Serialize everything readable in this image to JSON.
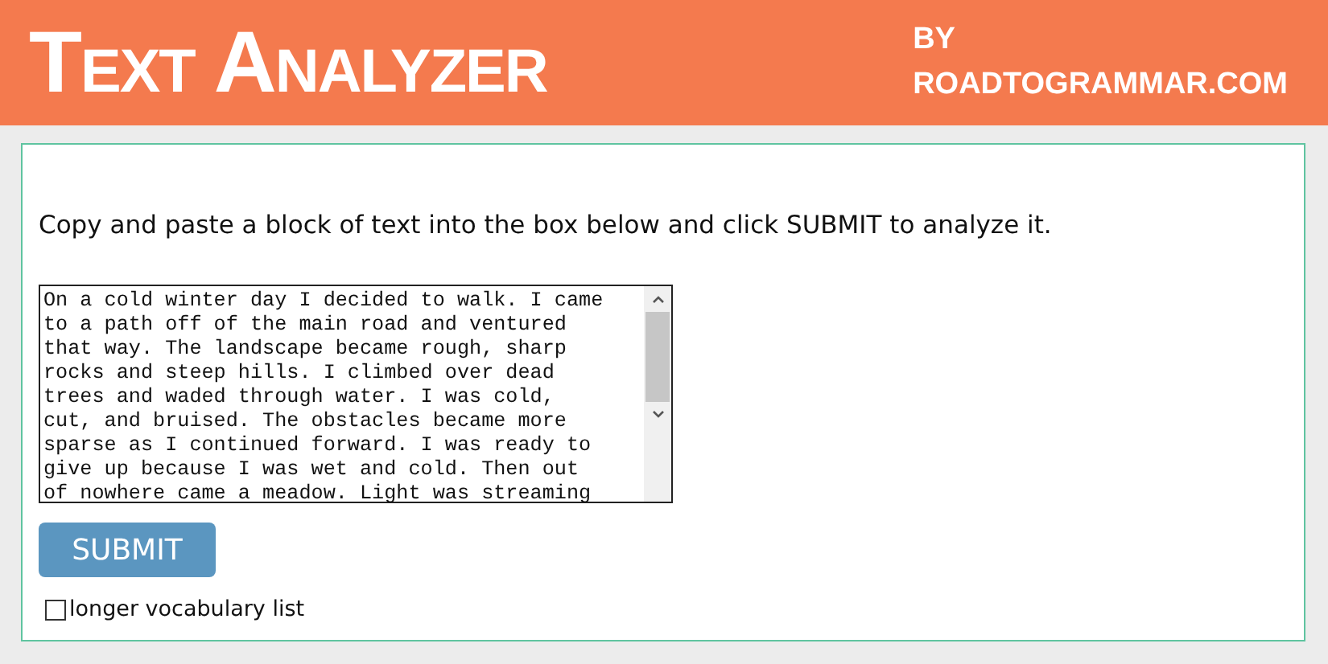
{
  "header": {
    "title": "Text Analyzer",
    "byline": [
      "BY",
      "ROADTOGRAMMAR.COM"
    ]
  },
  "instructions": "Copy and paste a block of text into the box below and click SUBMIT to analyze it.",
  "text_box": {
    "lines": [
      "On a cold winter day I decided to walk. I came",
      "to a path off of the main road and ventured",
      "that way. The landscape became rough, sharp",
      "rocks and steep hills. I climbed over dead",
      "trees and waded through water. I was cold,",
      "cut, and bruised. The obstacles became more",
      "sparse as I continued forward. I was ready to",
      "give up because I was wet and cold. Then out",
      "of nowhere came a meadow. Light was streaming"
    ]
  },
  "submit_button": "SUBMIT",
  "checkbox": {
    "label": "longer vocabulary list",
    "checked": false
  }
}
